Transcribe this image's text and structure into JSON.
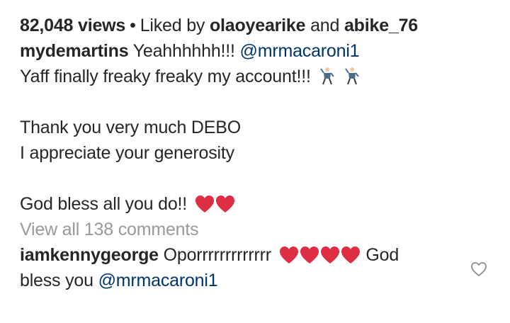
{
  "stats": {
    "views": "82,048 views",
    "separator": "•",
    "liked_by_prefix": "Liked by",
    "liker_1": "olaoyearike",
    "and": "and",
    "liker_2": "abike_76"
  },
  "caption": {
    "username": "mydemartins",
    "line1_text": "Yeahhhhhh!!!",
    "line1_mention": "@mrmacaroni1",
    "line2_text": "Yaff finally freaky freaky my account!!!",
    "line2_emoji": "dancer-icon",
    "line3_text": "Thank you very much DEBO",
    "line4_text": "I appreciate your generosity",
    "line5_text": "God bless all you do!!",
    "line5_emoji": "red-heart-icon"
  },
  "comments": {
    "view_all_label": "View all 138 comments",
    "items": [
      {
        "username": "iamkennygeorge",
        "text_before": "Oporrrrrrrrrrrrr",
        "text_after": "God",
        "line2_text": "bless you",
        "mention": "@mrmacaroni1",
        "emoji": "red-heart-icon"
      }
    ]
  },
  "colors": {
    "text": "#262626",
    "mention": "#003569",
    "muted": "#999999",
    "heart_emoji": "#dd2e44",
    "like_outline": "#8e8e8e"
  }
}
